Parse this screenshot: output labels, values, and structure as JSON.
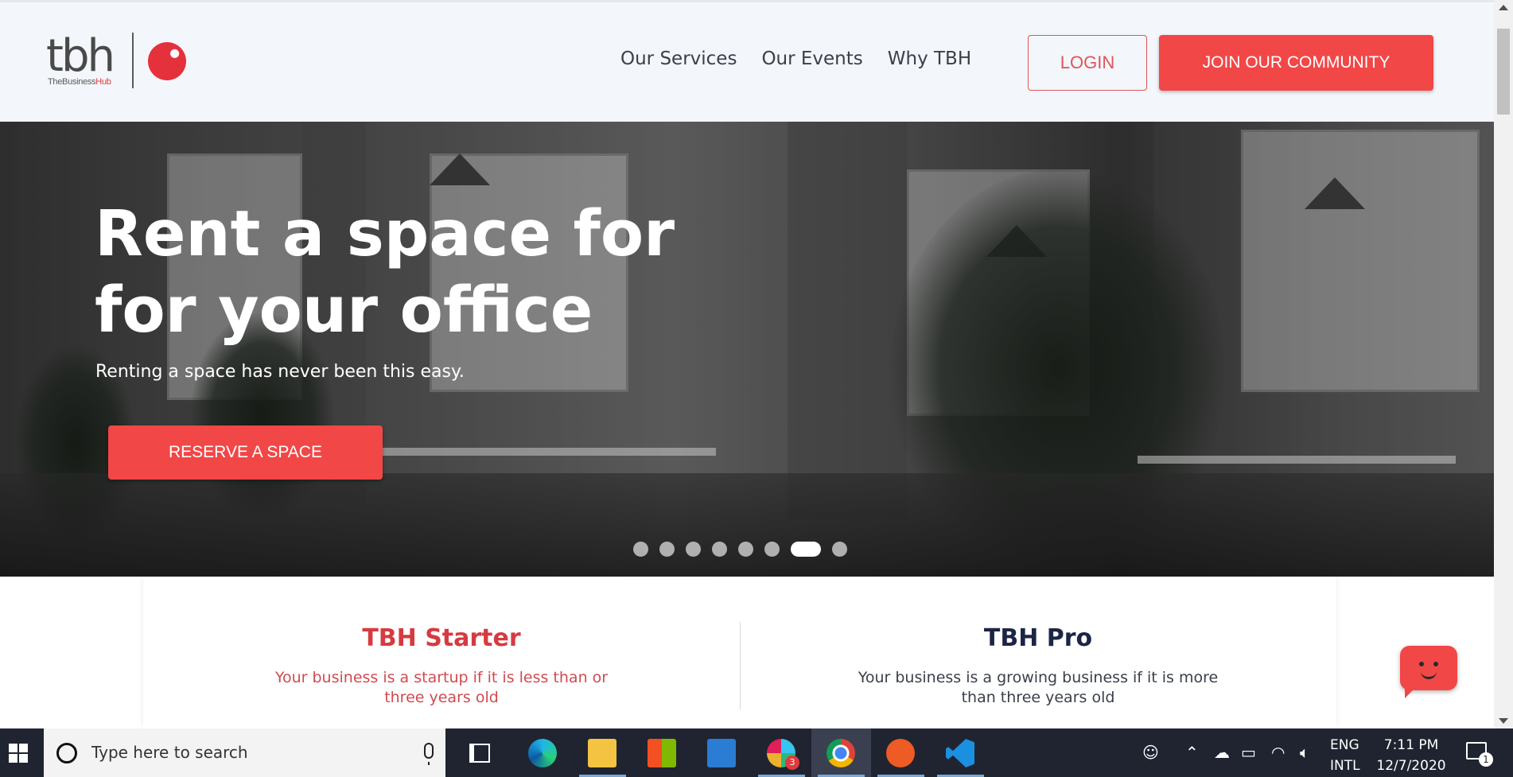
{
  "brand": {
    "logo_text": "tbh",
    "logo_sub_prefix": "TheBusiness",
    "logo_sub_accent": "Hub",
    "accent_color": "#f24747",
    "dark_color": "#1d2545"
  },
  "nav": {
    "links": [
      "Our Services",
      "Our Events",
      "Why TBH"
    ],
    "login_label": "LOGIN",
    "join_label": "JOIN OUR COMMUNITY"
  },
  "hero": {
    "title_line1": "Rent a space for",
    "title_line2": "for your office",
    "subtitle": "Renting a space has never been this easy.",
    "cta_label": "RESERVE A SPACE",
    "carousel": {
      "count": 8,
      "active_index": 6
    }
  },
  "plans": [
    {
      "title": "TBH Starter",
      "description": "Your business is a startup if it is less than or three years old"
    },
    {
      "title": "TBH Pro",
      "description": "Your business is a growing business if it is more than three years old"
    }
  ],
  "taskbar": {
    "search_placeholder": "Type here to search",
    "apps": [
      "task-view",
      "edge",
      "file-explorer",
      "microsoft-store",
      "mail",
      "slack",
      "chrome",
      "postman",
      "vscode"
    ],
    "slack_badge": "3",
    "lang_line1": "ENG",
    "lang_line2": "INTL",
    "time": "7:11 PM",
    "date": "12/7/2020",
    "notification_count": "1"
  }
}
